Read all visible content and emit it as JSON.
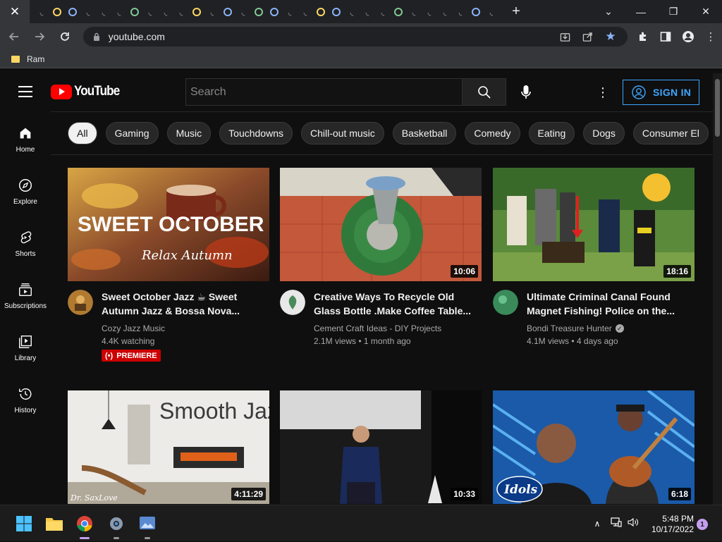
{
  "browser": {
    "url": "youtube.com",
    "bookmark_folder": "Ram"
  },
  "youtube": {
    "logo_text": "YouTube",
    "search_placeholder": "Search",
    "signin_label": "SIGN IN",
    "sidebar": [
      {
        "label": "Home",
        "icon": "home-icon"
      },
      {
        "label": "Explore",
        "icon": "explore-icon"
      },
      {
        "label": "Shorts",
        "icon": "shorts-icon"
      },
      {
        "label": "Subscriptions",
        "icon": "subscriptions-icon"
      },
      {
        "label": "Library",
        "icon": "library-icon"
      },
      {
        "label": "History",
        "icon": "history-icon"
      }
    ],
    "chips": [
      "All",
      "Gaming",
      "Music",
      "Touchdowns",
      "Chill-out music",
      "Basketball",
      "Comedy",
      "Eating",
      "Dogs",
      "Consumer El"
    ],
    "videos": [
      {
        "title": "Sweet October Jazz ☕ Sweet Autumn Jazz & Bossa Nova...",
        "channel": "Cozy Jazz Music",
        "stats": "4.4K watching",
        "badge": "PREMIERE",
        "duration": "",
        "thumb_text": "SWEET OCTOBER JAZZ",
        "thumb_sub": "Relax Autumn"
      },
      {
        "title": "Creative Ways To Recycle Old Glass Bottle .Make Coffee Table...",
        "channel": "Cement Craft Ideas - DIY Projects",
        "stats": "2.1M views • 1 month ago",
        "duration": "10:06"
      },
      {
        "title": "Ultimate Criminal Canal Found Magnet Fishing! Police on the...",
        "channel": "Bondi Treasure Hunter",
        "stats": "4.1M views • 4 days ago",
        "duration": "18:16",
        "verified": true
      },
      {
        "thumb_text": "Smooth Jazz",
        "thumb_sub": "Dr. SaxLove",
        "duration": "4:11:29"
      },
      {
        "duration": "10:33"
      },
      {
        "thumb_text": "Idols",
        "duration": "6:18"
      }
    ]
  },
  "taskbar": {
    "time": "5:48 PM",
    "date": "10/17/2022",
    "notifications": "1"
  }
}
